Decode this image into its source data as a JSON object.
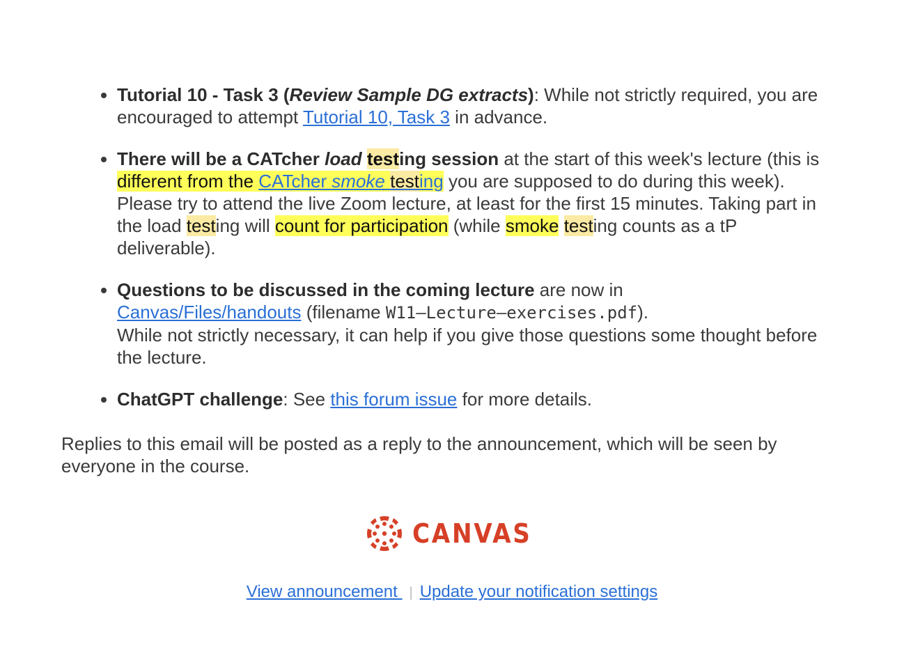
{
  "items": [
    {
      "bold_a": "Tutorial 10 - Task 3 (",
      "bold_italic": "Review Sample DG extracts",
      "bold_b": ")",
      "text_a": ": While not strictly required, you are encouraged to attempt ",
      "link": "Tutorial 10, Task 3",
      "text_b": " in advance."
    },
    {
      "bold_a": "There will be a CATcher ",
      "bold_italic": "load",
      "bold_space": " ",
      "bold_hl": "test",
      "bold_b": "ing session",
      "t1": " at the start of this week's lecture (this is ",
      "hl1": "different from the ",
      "link_a": "CATcher ",
      "link_italic": "smoke",
      "link_b": " ",
      "link_hl": "test",
      "link_c": "ing",
      "t2": " you are supposed to do during this week). Please try to attend the live Zoom lecture, at least for the first 15 minutes. Taking part in the load ",
      "hl2": "test",
      "t3": "ing will ",
      "hl3": "count for participation",
      "t4": " (while ",
      "hl4": "smoke",
      "t5": " ",
      "hl5": "test",
      "t6": "ing counts as a tP deliverable)."
    },
    {
      "bold": "Questions to be discussed in the coming lecture",
      "text_a": " are now in ",
      "link": "Canvas/Files/handouts",
      "text_b": " (filename ",
      "code": "W11–Lecture–exercises.pdf",
      "text_c": ").",
      "text_d": "While not strictly necessary, it can help if you give those questions some thought before the lecture."
    },
    {
      "bold": "ChatGPT challenge",
      "text_a": ": See ",
      "link": "this forum issue",
      "text_b": " for more details."
    }
  ],
  "footer_note": "Replies to this email will be posted as a reply to the announcement, which will be seen by everyone in the course.",
  "logo": {
    "text": "CANVAS",
    "icon": "canvas-logo-icon",
    "color": "#d64027"
  },
  "links": {
    "view": "View announcement ",
    "separator": "|",
    "settings": "Update your notification settings"
  },
  "colors": {
    "link": "#2a6fd6",
    "highlight_yellow": "#ffff5a",
    "highlight_soft": "#fbeaa3"
  }
}
